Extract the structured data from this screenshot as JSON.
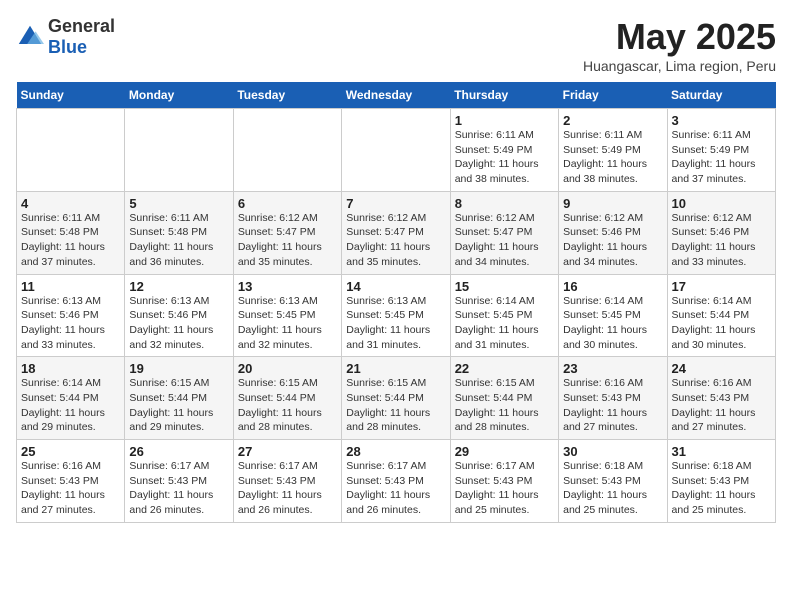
{
  "header": {
    "logo_general": "General",
    "logo_blue": "Blue",
    "title": "May 2025",
    "subtitle": "Huangascar, Lima region, Peru"
  },
  "days_of_week": [
    "Sunday",
    "Monday",
    "Tuesday",
    "Wednesday",
    "Thursday",
    "Friday",
    "Saturday"
  ],
  "weeks": [
    [
      {
        "day": "",
        "info": ""
      },
      {
        "day": "",
        "info": ""
      },
      {
        "day": "",
        "info": ""
      },
      {
        "day": "",
        "info": ""
      },
      {
        "day": "1",
        "info": "Sunrise: 6:11 AM\nSunset: 5:49 PM\nDaylight: 11 hours\nand 38 minutes."
      },
      {
        "day": "2",
        "info": "Sunrise: 6:11 AM\nSunset: 5:49 PM\nDaylight: 11 hours\nand 38 minutes."
      },
      {
        "day": "3",
        "info": "Sunrise: 6:11 AM\nSunset: 5:49 PM\nDaylight: 11 hours\nand 37 minutes."
      }
    ],
    [
      {
        "day": "4",
        "info": "Sunrise: 6:11 AM\nSunset: 5:48 PM\nDaylight: 11 hours\nand 37 minutes."
      },
      {
        "day": "5",
        "info": "Sunrise: 6:11 AM\nSunset: 5:48 PM\nDaylight: 11 hours\nand 36 minutes."
      },
      {
        "day": "6",
        "info": "Sunrise: 6:12 AM\nSunset: 5:47 PM\nDaylight: 11 hours\nand 35 minutes."
      },
      {
        "day": "7",
        "info": "Sunrise: 6:12 AM\nSunset: 5:47 PM\nDaylight: 11 hours\nand 35 minutes."
      },
      {
        "day": "8",
        "info": "Sunrise: 6:12 AM\nSunset: 5:47 PM\nDaylight: 11 hours\nand 34 minutes."
      },
      {
        "day": "9",
        "info": "Sunrise: 6:12 AM\nSunset: 5:46 PM\nDaylight: 11 hours\nand 34 minutes."
      },
      {
        "day": "10",
        "info": "Sunrise: 6:12 AM\nSunset: 5:46 PM\nDaylight: 11 hours\nand 33 minutes."
      }
    ],
    [
      {
        "day": "11",
        "info": "Sunrise: 6:13 AM\nSunset: 5:46 PM\nDaylight: 11 hours\nand 33 minutes."
      },
      {
        "day": "12",
        "info": "Sunrise: 6:13 AM\nSunset: 5:46 PM\nDaylight: 11 hours\nand 32 minutes."
      },
      {
        "day": "13",
        "info": "Sunrise: 6:13 AM\nSunset: 5:45 PM\nDaylight: 11 hours\nand 32 minutes."
      },
      {
        "day": "14",
        "info": "Sunrise: 6:13 AM\nSunset: 5:45 PM\nDaylight: 11 hours\nand 31 minutes."
      },
      {
        "day": "15",
        "info": "Sunrise: 6:14 AM\nSunset: 5:45 PM\nDaylight: 11 hours\nand 31 minutes."
      },
      {
        "day": "16",
        "info": "Sunrise: 6:14 AM\nSunset: 5:45 PM\nDaylight: 11 hours\nand 30 minutes."
      },
      {
        "day": "17",
        "info": "Sunrise: 6:14 AM\nSunset: 5:44 PM\nDaylight: 11 hours\nand 30 minutes."
      }
    ],
    [
      {
        "day": "18",
        "info": "Sunrise: 6:14 AM\nSunset: 5:44 PM\nDaylight: 11 hours\nand 29 minutes."
      },
      {
        "day": "19",
        "info": "Sunrise: 6:15 AM\nSunset: 5:44 PM\nDaylight: 11 hours\nand 29 minutes."
      },
      {
        "day": "20",
        "info": "Sunrise: 6:15 AM\nSunset: 5:44 PM\nDaylight: 11 hours\nand 28 minutes."
      },
      {
        "day": "21",
        "info": "Sunrise: 6:15 AM\nSunset: 5:44 PM\nDaylight: 11 hours\nand 28 minutes."
      },
      {
        "day": "22",
        "info": "Sunrise: 6:15 AM\nSunset: 5:44 PM\nDaylight: 11 hours\nand 28 minutes."
      },
      {
        "day": "23",
        "info": "Sunrise: 6:16 AM\nSunset: 5:43 PM\nDaylight: 11 hours\nand 27 minutes."
      },
      {
        "day": "24",
        "info": "Sunrise: 6:16 AM\nSunset: 5:43 PM\nDaylight: 11 hours\nand 27 minutes."
      }
    ],
    [
      {
        "day": "25",
        "info": "Sunrise: 6:16 AM\nSunset: 5:43 PM\nDaylight: 11 hours\nand 27 minutes."
      },
      {
        "day": "26",
        "info": "Sunrise: 6:17 AM\nSunset: 5:43 PM\nDaylight: 11 hours\nand 26 minutes."
      },
      {
        "day": "27",
        "info": "Sunrise: 6:17 AM\nSunset: 5:43 PM\nDaylight: 11 hours\nand 26 minutes."
      },
      {
        "day": "28",
        "info": "Sunrise: 6:17 AM\nSunset: 5:43 PM\nDaylight: 11 hours\nand 26 minutes."
      },
      {
        "day": "29",
        "info": "Sunrise: 6:17 AM\nSunset: 5:43 PM\nDaylight: 11 hours\nand 25 minutes."
      },
      {
        "day": "30",
        "info": "Sunrise: 6:18 AM\nSunset: 5:43 PM\nDaylight: 11 hours\nand 25 minutes."
      },
      {
        "day": "31",
        "info": "Sunrise: 6:18 AM\nSunset: 5:43 PM\nDaylight: 11 hours\nand 25 minutes."
      }
    ]
  ]
}
